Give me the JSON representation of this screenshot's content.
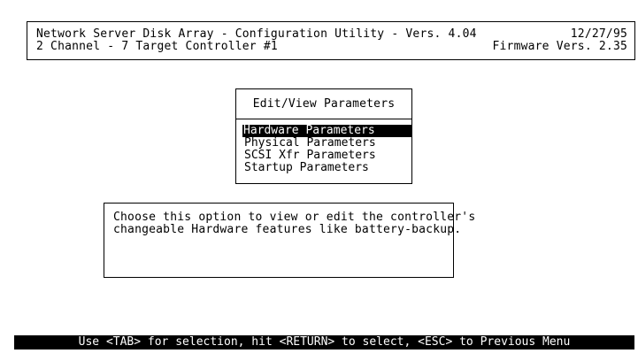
{
  "header": {
    "title_line": "Network Server Disk Array - Configuration Utility - Vers. 4.04",
    "date": "12/27/95",
    "subtitle_line": "2 Channel - 7 Target Controller #1",
    "firmware": "Firmware Vers. 2.35"
  },
  "menu": {
    "title": "Edit/View Parameters",
    "items": [
      {
        "label": "Hardware Parameters",
        "selected": true
      },
      {
        "label": "Physical Parameters",
        "selected": false
      },
      {
        "label": "SCSI Xfr Parameters",
        "selected": false
      },
      {
        "label": "Startup Parameters",
        "selected": false
      }
    ]
  },
  "description": {
    "line1": "Choose this option to view or edit the controller's",
    "line2": "changeable Hardware features like battery-backup."
  },
  "statusbar": {
    "text": "Use <TAB> for selection, hit <RETURN> to select, <ESC> to Previous Menu"
  }
}
